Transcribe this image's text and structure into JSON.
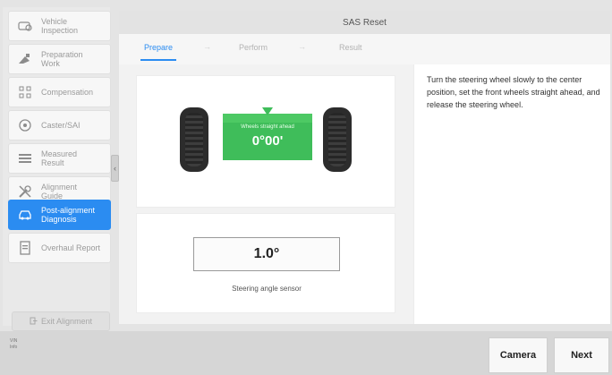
{
  "window_title": "SAS Reset",
  "sidebar": {
    "items": [
      {
        "label_line1": "Vehicle",
        "label_line2": "Inspection",
        "icon": "car-inspection-icon",
        "active": false
      },
      {
        "label_line1": "Preparation",
        "label_line2": "Work",
        "icon": "tools-icon",
        "active": false
      },
      {
        "label_line1": "Compensation",
        "label_line2": "",
        "icon": "compensation-icon",
        "active": false
      },
      {
        "label_line1": "Caster/SAI",
        "label_line2": "",
        "icon": "wheel-icon",
        "active": false
      },
      {
        "label_line1": "Measured",
        "label_line2": "Result",
        "icon": "list-icon",
        "active": false
      },
      {
        "label_line1": "Alignment",
        "label_line2": "Guide",
        "icon": "wrench-icon",
        "active": false
      },
      {
        "label_line1": "Post-alignment",
        "label_line2": "Diagnosis",
        "icon": "car-diagnosis-icon",
        "active": true
      },
      {
        "label_line1": "Overhaul Report",
        "label_line2": "",
        "icon": "report-icon",
        "active": false
      }
    ],
    "exit_label": "Exit Alignment"
  },
  "steps": {
    "prepare": "Prepare",
    "perform": "Perform",
    "result": "Result",
    "arrow": "→"
  },
  "wheel_display": {
    "caption": "Wheels straight ahead",
    "value": "0°00'"
  },
  "sensor": {
    "value": "1.0°",
    "label": "Steering angle sensor"
  },
  "instructions": "Turn the steering wheel slowly to the center position, set the front wheels straight ahead, and release the steering wheel.",
  "bottom": {
    "vin_line1": "VIN",
    "vin_line2": "Info",
    "camera_label": "Camera",
    "next_label": "Next"
  },
  "colors": {
    "accent": "#2b8cf1",
    "green": "#3fbd5a"
  }
}
